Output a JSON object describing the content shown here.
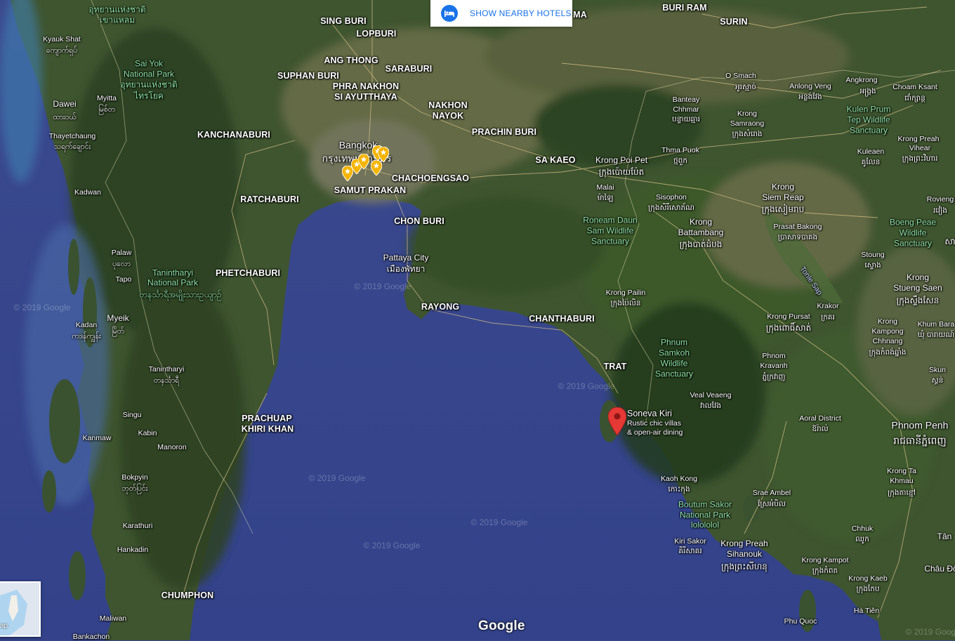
{
  "hotels_button": {
    "label": "SHOW NEARBY HOTELS",
    "icon": "hotel-bed-icon"
  },
  "logo": "Google",
  "minimap_label": "ap",
  "selected_place": {
    "name": "Soneva Kiri",
    "description_line1": "Rustic chic villas",
    "description_line2": "& open-air dining",
    "pin_color": "#e53935"
  },
  "hotel_pin_color": "#f4b400",
  "watermarks": [
    "© 2019 Google",
    "© 2019 Google",
    "© 2019 Google",
    "© 2019 Google",
    "© 2019 Google",
    "© 2019 Google",
    "© 2019 Google"
  ],
  "labels": [
    {
      "id": "sing-buri",
      "text": "SING BURI",
      "style": "big"
    },
    {
      "id": "lopburi",
      "text": "LOPBURI",
      "style": "big"
    },
    {
      "id": "ang-thong",
      "text": "ANG THONG",
      "style": "big"
    },
    {
      "id": "saraburi",
      "text": "SARABURI",
      "style": "big"
    },
    {
      "id": "suphan-buri",
      "text": "SUPHAN BURI",
      "style": "big"
    },
    {
      "id": "ayutthaya-1",
      "text": "PHRA NAKHON",
      "style": "big"
    },
    {
      "id": "ayutthaya-2",
      "text": "SI AYUTTHAYA",
      "style": "big"
    },
    {
      "id": "nakhon-nayok-1",
      "text": "NAKHON",
      "style": "big"
    },
    {
      "id": "nakhon-nayok-2",
      "text": "NAYOK",
      "style": "big"
    },
    {
      "id": "kanchanaburi",
      "text": "KANCHANABURI",
      "style": "big"
    },
    {
      "id": "prachin-buri",
      "text": "PRACHIN BURI",
      "style": "big"
    },
    {
      "id": "sa-kaeo",
      "text": "SA KAEO",
      "style": "big"
    },
    {
      "id": "bangkok",
      "text": "Bangkok",
      "style": "city"
    },
    {
      "id": "bangkok-thai",
      "text": "กรุงเทพมหานคร",
      "style": "city"
    },
    {
      "id": "chachoengsao",
      "text": "CHACHOENGSAO",
      "style": "big"
    },
    {
      "id": "samut-prakan",
      "text": "SAMUT PRAKAN",
      "style": "big"
    },
    {
      "id": "ratchaburi",
      "text": "RATCHABURI",
      "style": "big"
    },
    {
      "id": "chon-buri",
      "text": "CHON BURI",
      "style": "big"
    },
    {
      "id": "pattaya",
      "text": "Pattaya City",
      "style": "normal"
    },
    {
      "id": "pattaya-thai",
      "text": "เมืองพัทยา",
      "style": "normal"
    },
    {
      "id": "phetchaburi",
      "text": "PHETCHABURI",
      "style": "big"
    },
    {
      "id": "rayong",
      "text": "RAYONG",
      "style": "big"
    },
    {
      "id": "chanthaburi",
      "text": "CHANTHABURI",
      "style": "big"
    },
    {
      "id": "trat",
      "text": "TRAT",
      "style": "big"
    },
    {
      "id": "prachuap-1",
      "text": "PRACHUAP",
      "style": "big"
    },
    {
      "id": "prachuap-2",
      "text": "KHIRI KHAN",
      "style": "big"
    },
    {
      "id": "chumphon",
      "text": "CHUMPHON",
      "style": "big"
    },
    {
      "id": "buri-ram",
      "text": "BURI RAM",
      "style": "big"
    },
    {
      "id": "surin",
      "text": "SURIN",
      "style": "big"
    },
    {
      "id": "ma",
      "text": "MA",
      "style": "big"
    },
    {
      "id": "kyauk-shat",
      "text": "Kyauk Shat",
      "style": "small"
    },
    {
      "id": "kyauk-shat-my",
      "text": "ကျောက်ရှပ်",
      "style": "small"
    },
    {
      "id": "sai-yok-1",
      "text": "Sai Yok",
      "style": "park"
    },
    {
      "id": "sai-yok-2",
      "text": "National Park",
      "style": "park"
    },
    {
      "id": "sai-yok-thai-1",
      "text": "อุทยานแห่งชาติ",
      "style": "parksmall"
    },
    {
      "id": "sai-yok-thai-2",
      "text": "ไทรโยค",
      "style": "parksmall"
    },
    {
      "id": "top-thai-1",
      "text": "อุทยานแห่งชาติ",
      "style": "parksmall"
    },
    {
      "id": "top-thai-2",
      "text": "เขาแหลม",
      "style": "parksmall"
    },
    {
      "id": "myitta",
      "text": "Myitta",
      "style": "small"
    },
    {
      "id": "myitta-my",
      "text": "မြစ်တ",
      "style": "small"
    },
    {
      "id": "dawei",
      "text": "Dawei",
      "style": "normal"
    },
    {
      "id": "dawei-my",
      "text": "ထားဝယ်",
      "style": "small"
    },
    {
      "id": "thayetchaung",
      "text": "Thayetchaung",
      "style": "small"
    },
    {
      "id": "thayetchaung-my",
      "text": "သရက်ချောင်း",
      "style": "small"
    },
    {
      "id": "kadwan",
      "text": "Kadwan",
      "style": "small"
    },
    {
      "id": "palaw",
      "text": "Palaw",
      "style": "small"
    },
    {
      "id": "palaw-my",
      "text": "ပုလော",
      "style": "small"
    },
    {
      "id": "tapo",
      "text": "Tapo",
      "style": "small"
    },
    {
      "id": "tanintharyi-np-1",
      "text": "Tanintharyi",
      "style": "park"
    },
    {
      "id": "tanintharyi-np-2",
      "text": "National Park",
      "style": "park"
    },
    {
      "id": "tanintharyi-np-my",
      "text": "တနင်္သာရီအမျိုးသားဥယျာဉ်",
      "style": "parksmall"
    },
    {
      "id": "myeik",
      "text": "Myeik",
      "style": "normal"
    },
    {
      "id": "myeik-my",
      "text": "မြိတ်",
      "style": "small"
    },
    {
      "id": "kadan",
      "text": "Kadan",
      "style": "small"
    },
    {
      "id": "kadan-my",
      "text": "ကဒန်ကျွန်း",
      "style": "small"
    },
    {
      "id": "tanintharyi",
      "text": "Tanintharyi",
      "style": "small"
    },
    {
      "id": "tanintharyi-my",
      "text": "တနင်္သာရီ",
      "style": "small"
    },
    {
      "id": "singu",
      "text": "Singu",
      "style": "small"
    },
    {
      "id": "kabin",
      "text": "Kabin",
      "style": "small"
    },
    {
      "id": "kanmaw",
      "text": "Kanmaw",
      "style": "small"
    },
    {
      "id": "manoron",
      "text": "Manoron",
      "style": "small"
    },
    {
      "id": "bokpyin",
      "text": "Bokpyin",
      "style": "small"
    },
    {
      "id": "bokpyin-my",
      "text": "ဘုတ်ပြင်း",
      "style": "small"
    },
    {
      "id": "karathuri",
      "text": "Karathuri",
      "style": "small"
    },
    {
      "id": "hankadin",
      "text": "Hankadin",
      "style": "small"
    },
    {
      "id": "maliwan",
      "text": "Maliwan",
      "style": "small"
    },
    {
      "id": "bankachon",
      "text": "Bankachon",
      "style": "small"
    },
    {
      "id": "o-smach",
      "text": "O Smach",
      "style": "small"
    },
    {
      "id": "o-smach-km",
      "text": "អូរស្មាច់",
      "style": "small"
    },
    {
      "id": "anlong-veng",
      "text": "Anlong Veng",
      "style": "small"
    },
    {
      "id": "anlong-veng-km",
      "text": "អន្លង់វែង",
      "style": "small"
    },
    {
      "id": "angkrong",
      "text": "Angkrong",
      "style": "small"
    },
    {
      "id": "angkrong-km",
      "text": "អង្គ្រង",
      "style": "small"
    },
    {
      "id": "choam-ksant",
      "text": "Choam Ksant",
      "style": "small"
    },
    {
      "id": "choam-ksant-km",
      "text": "ជាំក្សាន្ត",
      "style": "small"
    },
    {
      "id": "kulen-1",
      "text": "Kulen Prum",
      "style": "park"
    },
    {
      "id": "kulen-2",
      "text": "Tep Wildlife",
      "style": "park"
    },
    {
      "id": "kulen-3",
      "text": "Sanctuary",
      "style": "park"
    },
    {
      "id": "banteay-1",
      "text": "Banteay",
      "style": "small"
    },
    {
      "id": "banteay-2",
      "text": "Chhmar",
      "style": "small"
    },
    {
      "id": "banteay-km",
      "text": "បន្ទាយឆ្មារ",
      "style": "small"
    },
    {
      "id": "krong-samraong-1",
      "text": "Krong",
      "style": "small"
    },
    {
      "id": "krong-samraong-2",
      "text": "Samraong",
      "style": "small"
    },
    {
      "id": "krong-samraong-km",
      "text": "ក្រុងសំរោង",
      "style": "small"
    },
    {
      "id": "thma-puok",
      "text": "Thma Puok",
      "style": "small"
    },
    {
      "id": "thma-puok-km",
      "text": "ថ្មពួក",
      "style": "small"
    },
    {
      "id": "krong-preah-vihear-1",
      "text": "Krong Preah",
      "style": "small"
    },
    {
      "id": "krong-preah-vihear-2",
      "text": "Vihear",
      "style": "small"
    },
    {
      "id": "krong-preah-vihear-km",
      "text": "ក្រុងព្រះវិហារ",
      "style": "small"
    },
    {
      "id": "kuleaen",
      "text": "Kuleaen",
      "style": "small"
    },
    {
      "id": "kuleaen-km",
      "text": "គូលែន",
      "style": "small"
    },
    {
      "id": "krong-poi-pet",
      "text": "Krong Poi Pet",
      "style": "normal"
    },
    {
      "id": "krong-poi-pet-km",
      "text": "ក្រុងប៉ោយប៉ែត",
      "style": "normal"
    },
    {
      "id": "malai",
      "text": "Malai",
      "style": "small"
    },
    {
      "id": "malai-km",
      "text": "ម៉ាឡៃ",
      "style": "small"
    },
    {
      "id": "sisophon",
      "text": "Sisophon",
      "style": "small"
    },
    {
      "id": "sisophon-km",
      "text": "ក្រុងសិរីសោភ័ណ",
      "style": "small"
    },
    {
      "id": "siem-reap-1",
      "text": "Krong",
      "style": "normal"
    },
    {
      "id": "siem-reap-2",
      "text": "Siem Reap",
      "style": "normal"
    },
    {
      "id": "siem-reap-km",
      "text": "ក្រុងសៀមរាប",
      "style": "normal"
    },
    {
      "id": "rovieng",
      "text": "Rovieng",
      "style": "small"
    },
    {
      "id": "rovieng-km",
      "text": "រវៀង",
      "style": "small"
    },
    {
      "id": "roneam-1",
      "text": "Roneam Daun",
      "style": "park"
    },
    {
      "id": "roneam-2",
      "text": "Sam Wildlife",
      "style": "park"
    },
    {
      "id": "roneam-3",
      "text": "Sanctuary",
      "style": "park"
    },
    {
      "id": "battambang-1",
      "text": "Krong",
      "style": "normal"
    },
    {
      "id": "battambang-2",
      "text": "Battambang",
      "style": "normal"
    },
    {
      "id": "battambang-km",
      "text": "ក្រុងបាត់ដំបង",
      "style": "normal"
    },
    {
      "id": "prasat-bakong",
      "text": "Prasat Bakong",
      "style": "small"
    },
    {
      "id": "prasat-bakong-km",
      "text": "ប្រាសាទបាគង",
      "style": "small"
    },
    {
      "id": "boeng-peae-1",
      "text": "Boeng Peae",
      "style": "park"
    },
    {
      "id": "boeng-peae-2",
      "text": "Wildlife",
      "style": "park"
    },
    {
      "id": "boeng-peae-3",
      "text": "Sanctuary",
      "style": "park"
    },
    {
      "id": "sa-right",
      "text": "សា",
      "style": "normal"
    },
    {
      "id": "tonle-sap",
      "text": "Tonle Sap",
      "style": "water"
    },
    {
      "id": "stoung",
      "text": "Stoung",
      "style": "small"
    },
    {
      "id": "stoung-km",
      "text": "ស្ទោង",
      "style": "small"
    },
    {
      "id": "stueng-saen-1",
      "text": "Krong",
      "style": "normal"
    },
    {
      "id": "stueng-saen-2",
      "text": "Stueng Saen",
      "style": "normal"
    },
    {
      "id": "stueng-saen-km",
      "text": "ក្រុងស្ទឹងសែន",
      "style": "normal"
    },
    {
      "id": "krong-pailin",
      "text": "Krong Pailin",
      "style": "small"
    },
    {
      "id": "krong-pailin-km",
      "text": "ក្រុងប៉ៃលិន",
      "style": "small"
    },
    {
      "id": "krakor",
      "text": "Krakor",
      "style": "small"
    },
    {
      "id": "krakor-km",
      "text": "ក្រគរ",
      "style": "small"
    },
    {
      "id": "krong-pursat",
      "text": "Krong Pursat",
      "style": "small"
    },
    {
      "id": "krong-pursat-km",
      "text": "ក្រុងពោធិ៍សាត់",
      "style": "normal"
    },
    {
      "id": "kampong-chhnang-1",
      "text": "Krong",
      "style": "small"
    },
    {
      "id": "kampong-chhnang-2",
      "text": "Kampong",
      "style": "small"
    },
    {
      "id": "kampong-chhnang-3",
      "text": "Chhnang",
      "style": "small"
    },
    {
      "id": "kampong-chhnang-km",
      "text": "ក្រុងកំពង់ឆ្នាំង",
      "style": "small"
    },
    {
      "id": "khum-bara",
      "text": "Khum Bara",
      "style": "small"
    },
    {
      "id": "khum-bara-km",
      "text": "ឃុំ បារាយណ៍",
      "style": "small"
    },
    {
      "id": "phnum-samkoh-1",
      "text": "Phnum",
      "style": "park"
    },
    {
      "id": "phnum-samkoh-2",
      "text": "Samkoh",
      "style": "park"
    },
    {
      "id": "phnum-samkoh-3",
      "text": "Wildlife",
      "style": "park"
    },
    {
      "id": "phnum-samkoh-4",
      "text": "Sanctuary",
      "style": "park"
    },
    {
      "id": "phnom-kravanh-1",
      "text": "Phnom",
      "style": "small"
    },
    {
      "id": "phnom-kravanh-2",
      "text": "Kravanh",
      "style": "small"
    },
    {
      "id": "phnom-kravanh-km",
      "text": "ភ្នំក្រវាញ",
      "style": "small"
    },
    {
      "id": "skun",
      "text": "Skun",
      "style": "small"
    },
    {
      "id": "skun-km",
      "text": "ស្គន់",
      "style": "small"
    },
    {
      "id": "veal-veaeng",
      "text": "Veal Veaeng",
      "style": "small"
    },
    {
      "id": "veal-veaeng-km",
      "text": "វាលវែង",
      "style": "small"
    },
    {
      "id": "aoral",
      "text": "Aoral District",
      "style": "small"
    },
    {
      "id": "aoral-km",
      "text": "ឱរ៉ាល់",
      "style": "small"
    },
    {
      "id": "phnom-penh",
      "text": "Phnom Penh",
      "style": "city"
    },
    {
      "id": "phnom-penh-km",
      "text": "រាជធានីភ្នំពេញ",
      "style": "city"
    },
    {
      "id": "krong-ta-khmau-1",
      "text": "Krong Ta",
      "style": "small"
    },
    {
      "id": "krong-ta-khmau-2",
      "text": "Khmau",
      "style": "small"
    },
    {
      "id": "krong-ta-khmau-km",
      "text": "ក្រុងតាខ្មៅ",
      "style": "small"
    },
    {
      "id": "kaoh-kong",
      "text": "Kaoh Kong",
      "style": "small"
    },
    {
      "id": "kaoh-kong-km",
      "text": "កោះកុង",
      "style": "small"
    },
    {
      "id": "srae-ambel",
      "text": "Srae Ambel",
      "style": "small"
    },
    {
      "id": "srae-ambel-km",
      "text": "ស្រែអំបិល",
      "style": "small"
    },
    {
      "id": "boutum-1",
      "text": "Boutum Sakor",
      "style": "park"
    },
    {
      "id": "boutum-2",
      "text": "National Park",
      "style": "park"
    },
    {
      "id": "boutum-3",
      "text": "lolololol",
      "style": "park"
    },
    {
      "id": "chhuk",
      "text": "Chhuk",
      "style": "small"
    },
    {
      "id": "chhuk-km",
      "text": "ឈូក",
      "style": "small"
    },
    {
      "id": "kiri-sakor",
      "text": "Kiri Sakor",
      "style": "small"
    },
    {
      "id": "kiri-sakor-km",
      "text": "គិរីសាគរ",
      "style": "small"
    },
    {
      "id": "sihanouk-1",
      "text": "Krong Preah",
      "style": "normal"
    },
    {
      "id": "sihanouk-2",
      "text": "Sihanouk",
      "style": "normal"
    },
    {
      "id": "sihanouk-km",
      "text": "ក្រុងព្រះសីហនុ",
      "style": "normal"
    },
    {
      "id": "kampot",
      "text": "Krong Kampot",
      "style": "small"
    },
    {
      "id": "kampot-km",
      "text": "ក្រុងកំពត",
      "style": "small"
    },
    {
      "id": "kaeb",
      "text": "Krong Kaeb",
      "style": "small"
    },
    {
      "id": "kaeb-km",
      "text": "ក្រុងកែប",
      "style": "small"
    },
    {
      "id": "ta-tien",
      "text": "Tân",
      "style": "normal"
    },
    {
      "id": "chau-doc",
      "text": "Châu Đố",
      "style": "normal"
    },
    {
      "id": "ha-tien",
      "text": "Hà Tiên",
      "style": "small"
    },
    {
      "id": "phu-quoc",
      "text": "Phu Quoc",
      "style": "small"
    }
  ]
}
